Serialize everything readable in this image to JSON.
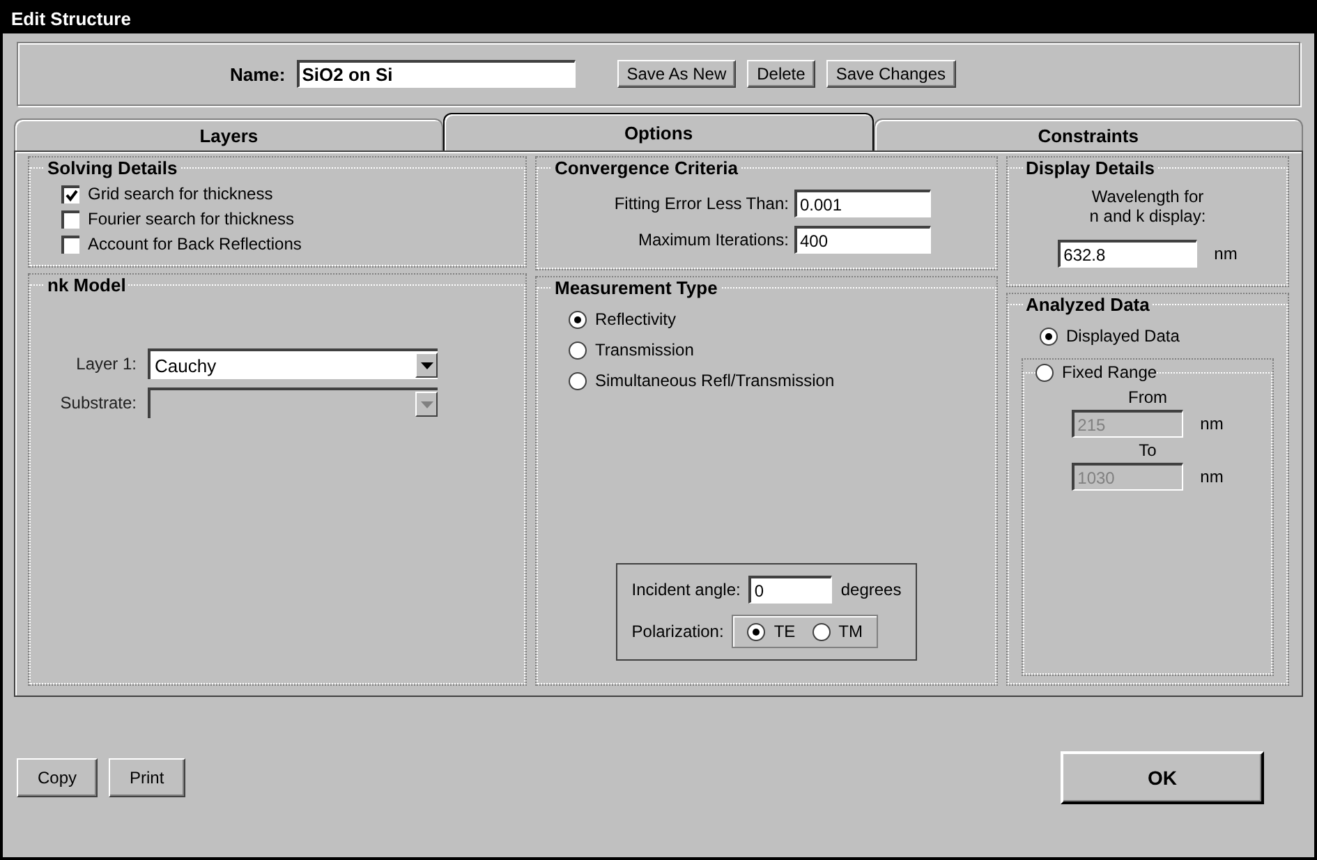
{
  "window": {
    "title": "Edit Structure"
  },
  "name_field": {
    "label": "Name:",
    "value": "SiO2 on Si"
  },
  "header_buttons": [
    "Save As New",
    "Delete",
    "Save Changes"
  ],
  "tabs": [
    {
      "label": "Layers",
      "selected": false
    },
    {
      "label": "Options",
      "selected": true
    },
    {
      "label": "Constraints",
      "selected": false
    }
  ],
  "solving_details": {
    "title": "Solving Details",
    "options": [
      {
        "label": "Grid search for thickness",
        "checked": true
      },
      {
        "label": "Fourier search for thickness",
        "checked": false
      },
      {
        "label": "Account for Back Reflections",
        "checked": false
      }
    ]
  },
  "nk_model": {
    "title": "nk Model",
    "rows": [
      {
        "label": "Layer 1:",
        "value": "Cauchy",
        "disabled": false
      },
      {
        "label": "Substrate:",
        "disabled": true
      }
    ]
  },
  "convergence": {
    "title": "Convergence Criteria",
    "fields": [
      {
        "label": "Fitting Error Less Than:",
        "value": "0.001"
      },
      {
        "label": "Maximum Iterations:",
        "value": "400"
      }
    ]
  },
  "measurement_type": {
    "title": "Measurement Type",
    "options": [
      {
        "label": "Reflectivity",
        "selected": true
      },
      {
        "label": "Transmission",
        "selected": false
      },
      {
        "label": "Simultaneous Refl/Transmission",
        "selected": false
      }
    ],
    "incident_angle": {
      "label": "Incident angle:",
      "value": "0",
      "unit": "degrees"
    },
    "polarization": {
      "label": "Polarization:",
      "options": [
        {
          "label": "TE",
          "selected": true
        },
        {
          "label": "TM",
          "selected": false
        }
      ]
    }
  },
  "display_details": {
    "title": "Display Details",
    "label": "Wavelength for n and k display:",
    "value": "632.8",
    "unit": "nm"
  },
  "analyzed_data": {
    "title": "Analyzed Data",
    "options": [
      {
        "label": "Displayed Data",
        "selected": true
      },
      {
        "label": "Fixed Range",
        "selected": false
      }
    ],
    "range": [
      {
        "label": "From",
        "value": "215",
        "unit": "nm",
        "disabled": true
      },
      {
        "label": "To",
        "value": "1030",
        "unit": "nm",
        "disabled": true
      }
    ]
  },
  "footer_buttons": [
    "Copy",
    "Print"
  ],
  "ok_button": "OK"
}
